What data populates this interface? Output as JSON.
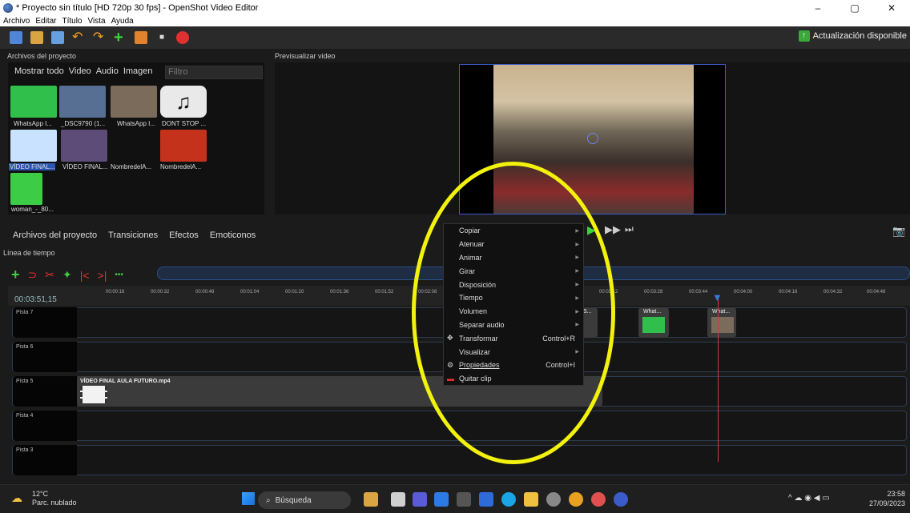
{
  "window": {
    "title": "* Proyecto sin título [HD 720p 30 fps] - OpenShot Video Editor",
    "minimize": "–",
    "maximize": "▢",
    "close": "✕"
  },
  "menu": [
    "Archivo",
    "Editar",
    "Título",
    "Vista",
    "Ayuda"
  ],
  "update_label": "Actualización disponible",
  "panels": {
    "files": "Archivos del proyecto",
    "preview": "Previsualizar video",
    "timeline": "Línea de tiempo"
  },
  "file_tabs": [
    "Mostrar todo",
    "Video",
    "Audio",
    "Imagen"
  ],
  "filter_placeholder": "Filtro",
  "files": [
    {
      "label": "WhatsApp I...",
      "color": "#2fbf4a"
    },
    {
      "label": "_DSC9790 (1...",
      "color": "#566f93"
    },
    {
      "label": "WhatsApp I...",
      "color": "#7a6b5a"
    },
    {
      "label": "DONT STOP ...",
      "color": "#e9e9e9"
    },
    {
      "label": "VÍDEO FINAL...",
      "color": "#c8e2ff"
    },
    {
      "label": "VÍDEO FINAL...",
      "color": "#5d4b78"
    },
    {
      "label": "NombredelA...",
      "color": "#111111"
    },
    {
      "label": "NombredelA...",
      "color": "#c4321c"
    },
    {
      "label": "woman_-_80...",
      "color": "#3ccc46"
    }
  ],
  "bottom_tabs": [
    "Archivos del proyecto",
    "Transiciones",
    "Efectos",
    "Emoticonos"
  ],
  "timecode": "00:03:51,15",
  "ticks": [
    "00:00:16",
    "00:00:32",
    "00:00:48",
    "00:01:04",
    "00:01:20",
    "00:01:36",
    "00:01:52",
    "00:02:08",
    "00:03:12",
    "00:03:28",
    "00:03:44",
    "00:04:00",
    "00:04:16",
    "00:04:32",
    "00:04:48"
  ],
  "tracks": [
    "Pista 7",
    "Pista 6",
    "Pista 5",
    "Pista 4",
    "Pista 3"
  ],
  "clips": {
    "main": "VÍDEO FINAL AULA FUTURO.mp4",
    "small1": "S...",
    "small2": "What...",
    "small3": "What..."
  },
  "context_menu": [
    {
      "label": "Copiar",
      "submenu": true
    },
    {
      "label": "Atenuar",
      "submenu": true
    },
    {
      "label": "Animar",
      "submenu": true
    },
    {
      "label": "Girar",
      "submenu": true
    },
    {
      "label": "Disposición",
      "submenu": true
    },
    {
      "label": "Tiempo",
      "submenu": true
    },
    {
      "label": "Volumen",
      "submenu": true
    },
    {
      "label": "Separar audio",
      "submenu": true
    },
    {
      "label": "Transformar",
      "shortcut": "Control+R",
      "icon": "move-icon"
    },
    {
      "label": "Visualizar",
      "submenu": true
    },
    {
      "label": "Propiedades",
      "shortcut": "Control+I",
      "icon": "gear-icon"
    },
    {
      "label": "Quitar clip",
      "icon": "remove-icon"
    }
  ],
  "taskbar": {
    "weather_temp": "12°C",
    "weather_desc": "Parc. nublado",
    "search": "Búsqueda",
    "time": "23:58",
    "date": "27/09/2023"
  },
  "colors": {
    "accent_yellow": "#f2f20c",
    "playhead": "#d13b3b",
    "guide_blue": "#3a5cc9"
  }
}
